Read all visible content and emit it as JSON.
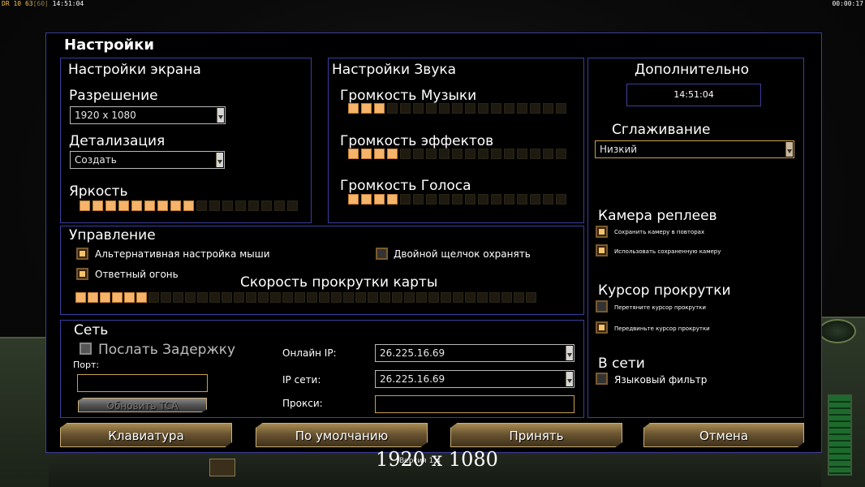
{
  "topbar": {
    "left_a": "DR",
    "left_b": "10",
    "left_c": "63",
    "left_d": "[60]",
    "left_time": "14:51:04",
    "right_time": "00:00:17"
  },
  "dialog": {
    "title": "Настройки"
  },
  "screen": {
    "title": "Настройки экрана",
    "resolution_label": "Разрешение",
    "resolution_value": "1920 x 1080",
    "detail_label": "Детализация",
    "detail_value": "Создать",
    "brightness_label": "Яркость",
    "brightness_level": 9,
    "brightness_max": 17
  },
  "sound": {
    "title": "Настройки Звука",
    "music_label": "Громкость Музыки",
    "music_level": 3,
    "effects_label": "Громкость эффектов",
    "effects_level": 4,
    "voice_label": "Громкость Голоса",
    "voice_level": 4,
    "max": 17
  },
  "extra": {
    "title": "Дополнительно",
    "clock": "14:51:04",
    "aa_label": "Сглаживание",
    "aa_value": "Низкий",
    "replay_cam_label": "Камера реплеев",
    "save_cam": "Сохранить камеру в повторах",
    "use_cam": "Использовать сохраненную камеру",
    "scroll_cursor_label": "Курсор прокрутки",
    "drag_cursor": "Перетяните курсор прокрутки",
    "move_cursor": "Передвиньте курсор прокрутки",
    "online_label": "В сети",
    "lang_filter": "Языковый фильтр"
  },
  "controls": {
    "title": "Управление",
    "alt_mouse": "Альтернативная настройка мыши",
    "double_click": "Двойной щелчок охранять",
    "retaliation": "Ответный огонь",
    "scroll_speed_label": "Скорость прокрутки карты",
    "scroll_level": 6,
    "scroll_max": 38
  },
  "network": {
    "title": "Сеть",
    "send_delay": "Послать Задержку",
    "port_label": "Порт:",
    "refresh_tca": "Обновить TCA",
    "online_ip_label": "Онлайн IP:",
    "online_ip_value": "26.225.16.69",
    "lan_ip_label": "IP сети:",
    "lan_ip_value": "26.225.16.69",
    "proxy_label": "Прокси:"
  },
  "buttons": {
    "keyboard": "Клавиатура",
    "defaults": "По умолчанию",
    "accept": "Принять",
    "cancel": "Отмена"
  },
  "footer": {
    "caption": "1920 x 1080",
    "version": "Версия 1.4"
  }
}
